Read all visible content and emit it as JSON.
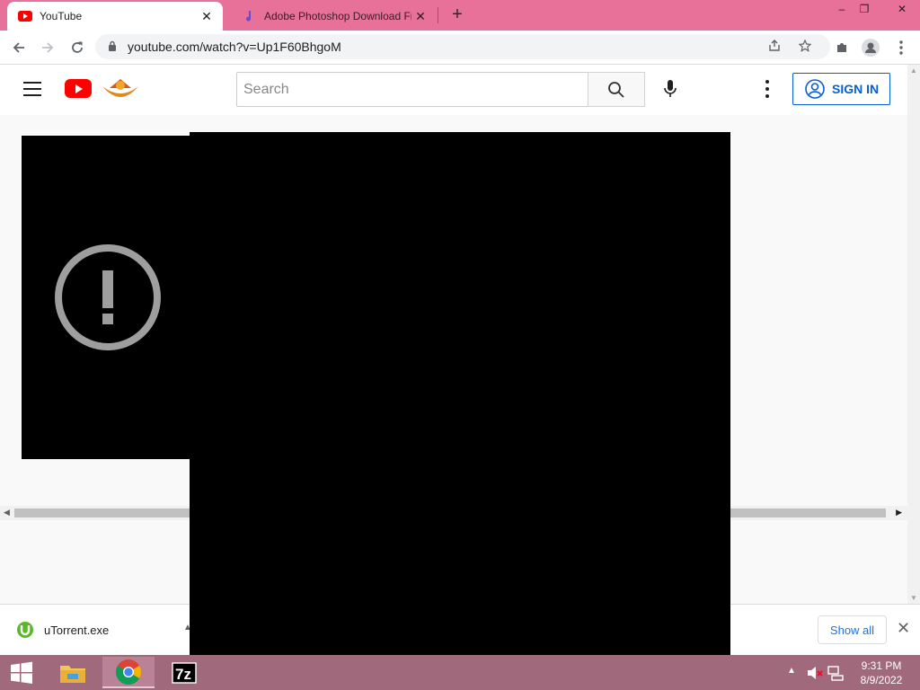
{
  "browser": {
    "tabs": [
      {
        "label": "YouTube",
        "active": true,
        "favicon": "youtube-favicon"
      },
      {
        "label": "Adobe Photoshop Download Fre",
        "active": false,
        "favicon": "music-note-favicon"
      }
    ],
    "new_tab_label": "+",
    "url": "youtube.com/watch?v=Up1F60BhgoM",
    "window_controls": {
      "minimize": "–",
      "restore": "❐",
      "close": "✕"
    }
  },
  "youtube": {
    "search_placeholder": "Search",
    "sign_in_label": "SIGN IN",
    "brand_color": "#ff0000",
    "accent_color": "#065fd4"
  },
  "download_bar": {
    "file_name": "uTorrent.exe",
    "show_all_label": "Show all"
  },
  "taskbar": {
    "apps": [
      "file-explorer",
      "chrome",
      "7zip",
      "app-4",
      "app-5",
      "app-6",
      "app-7",
      "app-8",
      "app-9",
      "app-10",
      "app-11"
    ],
    "time": "9:31 PM",
    "date": "8/9/2022"
  }
}
